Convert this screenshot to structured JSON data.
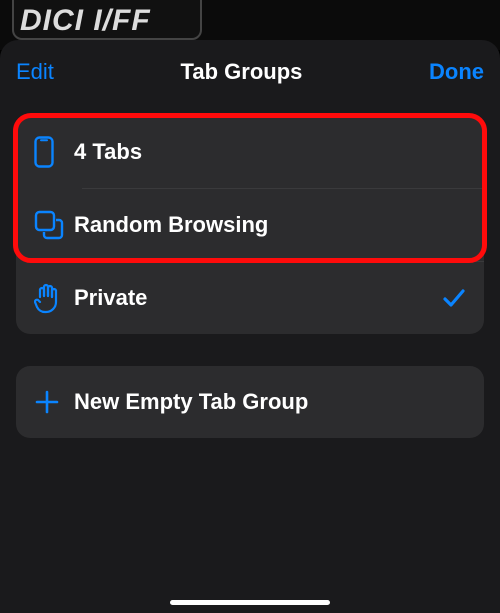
{
  "header": {
    "edit_label": "Edit",
    "title": "Tab Groups",
    "done_label": "Done"
  },
  "groups": {
    "tabs": {
      "label": "4 Tabs"
    },
    "random": {
      "label": "Random Browsing"
    },
    "private": {
      "label": "Private",
      "selected": true
    }
  },
  "actions": {
    "new_group_label": "New Empty Tab Group"
  },
  "colors": {
    "accent": "#0a84ff",
    "highlight": "#ff0b0b"
  }
}
